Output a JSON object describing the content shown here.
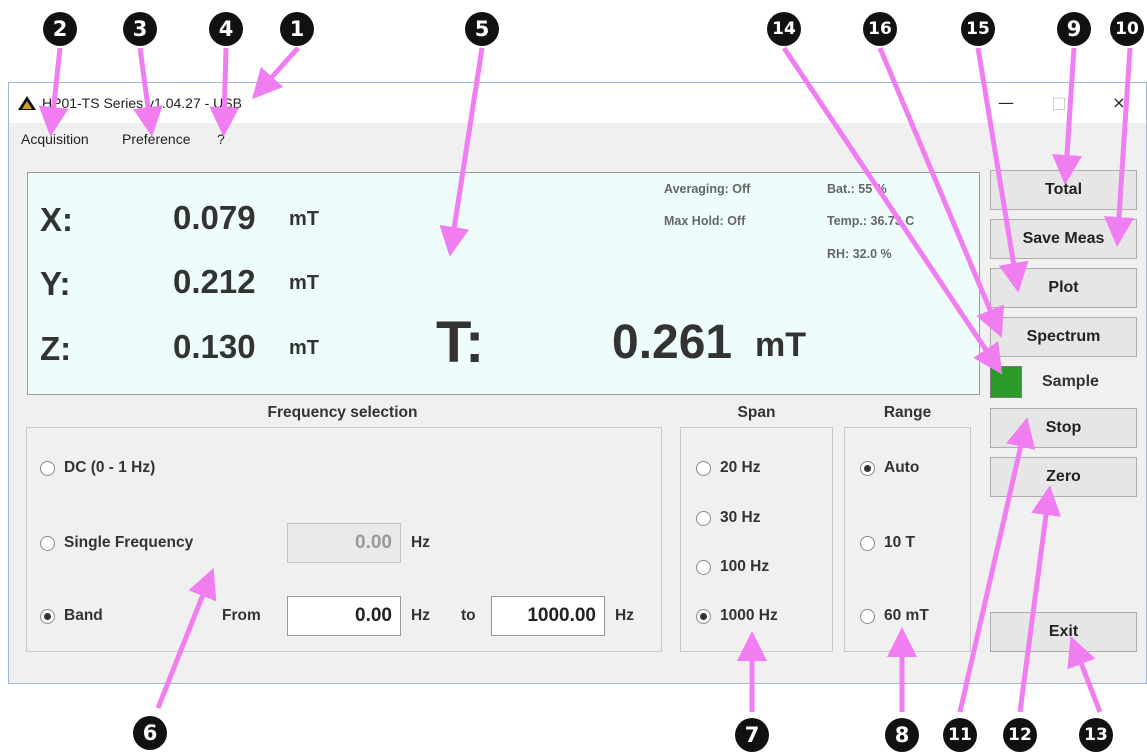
{
  "window": {
    "title": "HP01-TS Series v1.04.27 - USB",
    "controls": {
      "minimize": "—",
      "maximize": "□",
      "close": "×"
    }
  },
  "menu": [
    "Acquisition",
    "Preference",
    "?"
  ],
  "display": {
    "axes": [
      {
        "letter": "X:",
        "value": "0.079",
        "unit": "mT"
      },
      {
        "letter": "Y:",
        "value": "0.212",
        "unit": "mT"
      },
      {
        "letter": "Z:",
        "value": "0.130",
        "unit": "mT"
      }
    ],
    "total": {
      "letter": "T:",
      "value": "0.261",
      "unit": "mT"
    },
    "status": {
      "averaging": "Averaging: Off",
      "max_hold": "Max Hold: Off",
      "battery": "Bat.: 55 %",
      "temperature": "Temp.: 36.73 C",
      "humidity": "RH: 32.0 %"
    }
  },
  "frequency": {
    "title": "Frequency selection",
    "dc_label": "DC (0 - 1 Hz)",
    "single_label": "Single Frequency",
    "single_value": "0.00",
    "band_label": "Band",
    "from_label": "From",
    "from_value": "0.00",
    "to_label": "to",
    "to_value": "1000.00",
    "unit": "Hz",
    "selected": "Band"
  },
  "span": {
    "title": "Span",
    "options": [
      "20 Hz",
      "30 Hz",
      "100 Hz",
      "1000 Hz"
    ],
    "selected": "1000 Hz"
  },
  "range": {
    "title": "Range",
    "options": [
      "Auto",
      "10 T",
      "60 mT"
    ],
    "selected": "Auto"
  },
  "buttons": {
    "total": "Total",
    "save_meas": "Save Meas",
    "plot": "Plot",
    "spectrum": "Spectrum",
    "sample": "Sample",
    "stop": "Stop",
    "zero": "Zero",
    "exit": "Exit"
  },
  "colors": {
    "callout_arrow": "#f07ef0",
    "sample_led": "#2a9a2a",
    "display_bg": "#eefcfc"
  },
  "callouts": [
    "1",
    "2",
    "3",
    "4",
    "5",
    "6",
    "7",
    "8",
    "9",
    "10",
    "11",
    "12",
    "13",
    "14",
    "15",
    "16"
  ]
}
